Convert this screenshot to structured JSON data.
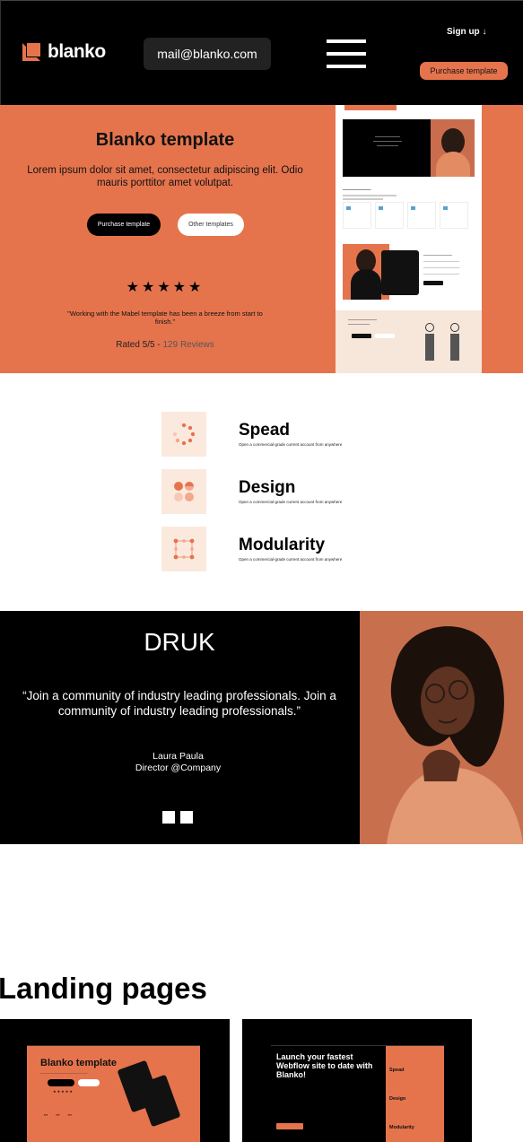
{
  "header": {
    "logo_text": "blanko",
    "email": "mail@blanko.com",
    "signup_label": "Sign up ↓",
    "purchase_label": "Purchase template"
  },
  "hero": {
    "title": "Blanko template",
    "description": "Lorem ipsum dolor sit amet, consectetur adipiscing elit. Odio mauris porttitor amet volutpat.",
    "primary_button": "Purchase template",
    "secondary_button": "Other templates",
    "stars": "★★★★★",
    "quote": "\"Working with the Mabel template has been a breeze from start to finish.\"",
    "rated_label": "Rated 5/5 - ",
    "reviews_label": "129 Reviews"
  },
  "features": [
    {
      "title": "Spead",
      "subtitle": "Open a commercial-grade current account from anywhere",
      "icon": "speed-dots-icon"
    },
    {
      "title": "Design",
      "subtitle": "Open a commercial-grade current account from anywhere",
      "icon": "design-circles-icon"
    },
    {
      "title": "Modularity",
      "subtitle": "Open a commercial-grade current account from anywhere",
      "icon": "modularity-grid-icon"
    }
  ],
  "testimonial": {
    "brand": "DRUK",
    "quote": "“Join a community of industry leading professionals. Join a community of industry leading professionals.”",
    "name": "Laura Paula",
    "role": "Director @Company"
  },
  "landing_pages": {
    "title": "Landing pages",
    "card1_title": "Blanko template",
    "card2_title": "Launch your fastest Webflow site to date with Blanko!",
    "card2_side": [
      "Spead",
      "Design",
      "Modularity"
    ]
  },
  "colors": {
    "accent": "#e5744d",
    "peach": "#fbe9de",
    "dark": "#000000"
  }
}
